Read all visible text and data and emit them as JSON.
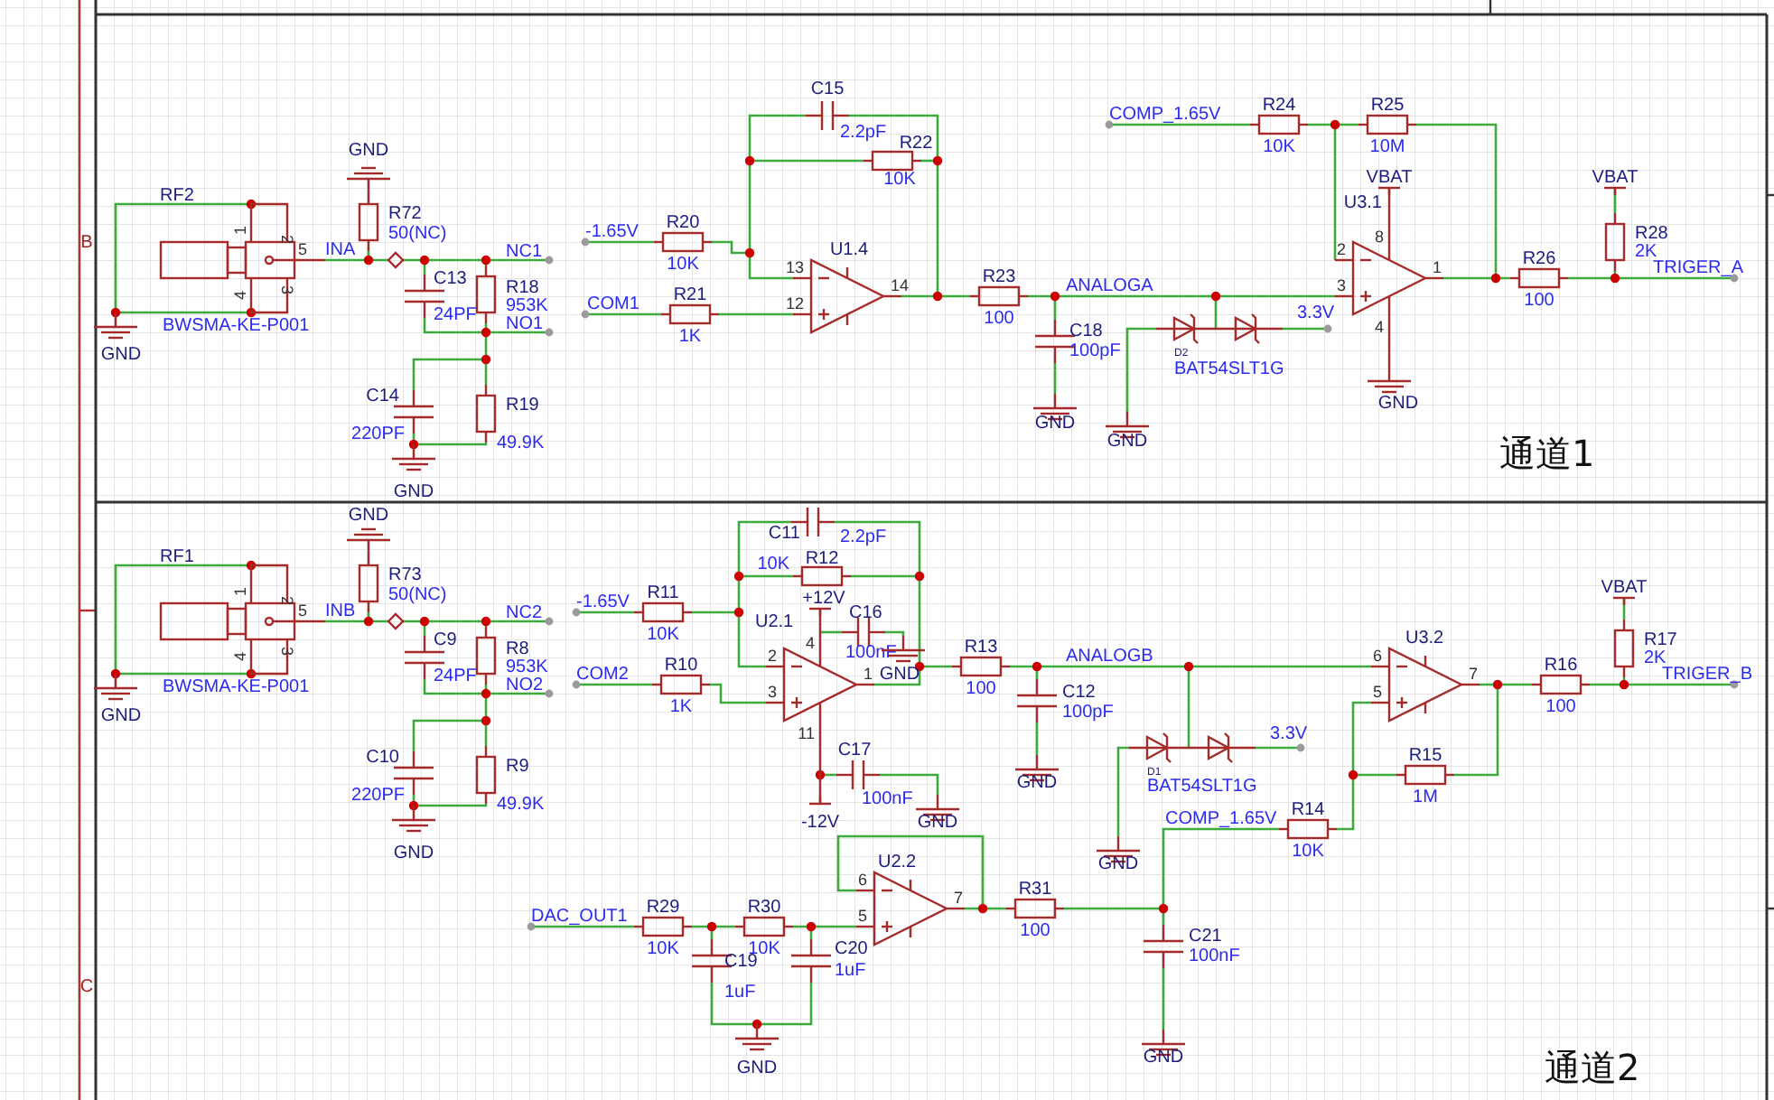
{
  "sheet": {
    "zone_labels": [
      "B",
      "C"
    ]
  },
  "channels": [
    {
      "title": "通道1",
      "parts": [
        {
          "kind": "connector",
          "ref": "RF2",
          "value": "BWSMA-KE-P001",
          "pins": [
            "1",
            "2",
            "4",
            "3",
            "5"
          ]
        },
        {
          "kind": "ground",
          "label": "GND"
        },
        {
          "kind": "ground",
          "label": "GND"
        },
        {
          "kind": "resistor",
          "ref": "R72",
          "value": "50(NC)"
        },
        {
          "kind": "net",
          "label": "INA"
        },
        {
          "kind": "capacitor",
          "ref": "C13",
          "value": "24PF"
        },
        {
          "kind": "net",
          "label": "NC1"
        },
        {
          "kind": "resistor",
          "ref": "R18",
          "value": "953K"
        },
        {
          "kind": "net",
          "label": "NO1"
        },
        {
          "kind": "capacitor",
          "ref": "C14",
          "value": "220PF"
        },
        {
          "kind": "resistor",
          "ref": "R19",
          "value": "49.9K"
        },
        {
          "kind": "ground",
          "label": "GND"
        },
        {
          "kind": "net",
          "label": "-1.65V"
        },
        {
          "kind": "resistor",
          "ref": "R20",
          "value": "10K"
        },
        {
          "kind": "net",
          "label": "COM1"
        },
        {
          "kind": "resistor",
          "ref": "R21",
          "value": "1K"
        },
        {
          "kind": "capacitor",
          "ref": "C15",
          "value": "2.2pF"
        },
        {
          "kind": "resistor",
          "ref": "R22",
          "value": "10K"
        },
        {
          "kind": "net",
          "label": "COMP_1.65V"
        },
        {
          "kind": "resistor",
          "ref": "R24",
          "value": "10K"
        },
        {
          "kind": "resistor",
          "ref": "R25",
          "value": "10M"
        },
        {
          "kind": "opamp",
          "ref": "U1.4",
          "pins": [
            "13",
            "12",
            "14"
          ]
        },
        {
          "kind": "resistor",
          "ref": "R23",
          "value": "100"
        },
        {
          "kind": "net",
          "label": "ANALOGA"
        },
        {
          "kind": "capacitor",
          "ref": "C18",
          "value": "100pF"
        },
        {
          "kind": "ground",
          "label": "GND"
        },
        {
          "kind": "diode_pair",
          "ref": "D2",
          "value": "BAT54SLT1G"
        },
        {
          "kind": "net",
          "label": "3.3V"
        },
        {
          "kind": "ground",
          "label": "GND"
        },
        {
          "kind": "power",
          "label": "VBAT"
        },
        {
          "kind": "opamp",
          "ref": "U3.1",
          "pins": [
            "2",
            "3",
            "1",
            "8",
            "4"
          ]
        },
        {
          "kind": "ground",
          "label": "GND"
        },
        {
          "kind": "resistor",
          "ref": "R26",
          "value": "100"
        },
        {
          "kind": "power",
          "label": "VBAT"
        },
        {
          "kind": "resistor",
          "ref": "R28",
          "value": "2K"
        },
        {
          "kind": "net",
          "label": "TRIGER_A"
        }
      ]
    },
    {
      "title": "通道2",
      "parts": [
        {
          "kind": "connector",
          "ref": "RF1",
          "value": "BWSMA-KE-P001",
          "pins": [
            "1",
            "2",
            "4",
            "3",
            "5"
          ]
        },
        {
          "kind": "ground",
          "label": "GND"
        },
        {
          "kind": "ground",
          "label": "GND"
        },
        {
          "kind": "resistor",
          "ref": "R73",
          "value": "50(NC)"
        },
        {
          "kind": "net",
          "label": "INB"
        },
        {
          "kind": "capacitor",
          "ref": "C9",
          "value": "24PF"
        },
        {
          "kind": "net",
          "label": "NC2"
        },
        {
          "kind": "resistor",
          "ref": "R8",
          "value": "953K"
        },
        {
          "kind": "net",
          "label": "NO2"
        },
        {
          "kind": "capacitor",
          "ref": "C10",
          "value": "220PF"
        },
        {
          "kind": "resistor",
          "ref": "R9",
          "value": "49.9K"
        },
        {
          "kind": "ground",
          "label": "GND"
        },
        {
          "kind": "net",
          "label": "-1.65V"
        },
        {
          "kind": "resistor",
          "ref": "R11",
          "value": "10K"
        },
        {
          "kind": "net",
          "label": "COM2"
        },
        {
          "kind": "resistor",
          "ref": "R10",
          "value": "1K"
        },
        {
          "kind": "opamp",
          "ref": "U2.1",
          "pins": [
            "2",
            "3",
            "1",
            "4",
            "11"
          ]
        },
        {
          "kind": "power",
          "label": "+12V"
        },
        {
          "kind": "capacitor",
          "ref": "C16",
          "value": "100nF"
        },
        {
          "kind": "ground",
          "label": "GND"
        },
        {
          "kind": "capacitor",
          "ref": "C11",
          "value": "2.2pF"
        },
        {
          "kind": "resistor",
          "ref": "R12",
          "value": "10K"
        },
        {
          "kind": "capacitor",
          "ref": "C17",
          "value": "100nF"
        },
        {
          "kind": "power",
          "label": "-12V"
        },
        {
          "kind": "ground",
          "label": "GND"
        },
        {
          "kind": "resistor",
          "ref": "R13",
          "value": "100"
        },
        {
          "kind": "net",
          "label": "ANALOGB"
        },
        {
          "kind": "capacitor",
          "ref": "C12",
          "value": "100pF"
        },
        {
          "kind": "ground",
          "label": "GND"
        },
        {
          "kind": "diode_pair",
          "ref": "D1",
          "value": "BAT54SLT1G"
        },
        {
          "kind": "net",
          "label": "3.3V"
        },
        {
          "kind": "ground",
          "label": "GND"
        },
        {
          "kind": "opamp",
          "ref": "U3.2",
          "pins": [
            "6",
            "5",
            "7"
          ]
        },
        {
          "kind": "resistor",
          "ref": "R16",
          "value": "100"
        },
        {
          "kind": "power",
          "label": "VBAT"
        },
        {
          "kind": "resistor",
          "ref": "R17",
          "value": "2K"
        },
        {
          "kind": "net",
          "label": "TRIGER_B"
        },
        {
          "kind": "resistor",
          "ref": "R15",
          "value": "1M"
        },
        {
          "kind": "resistor",
          "ref": "R14",
          "value": "10K"
        },
        {
          "kind": "net",
          "label": "COMP_1.65V"
        },
        {
          "kind": "opamp",
          "ref": "U2.2",
          "pins": [
            "6",
            "5",
            "7"
          ]
        },
        {
          "kind": "resistor",
          "ref": "R31",
          "value": "100"
        },
        {
          "kind": "capacitor",
          "ref": "C21",
          "value": "100nF"
        },
        {
          "kind": "ground",
          "label": "GND"
        },
        {
          "kind": "net",
          "label": "DAC_OUT1"
        },
        {
          "kind": "resistor",
          "ref": "R29",
          "value": "10K"
        },
        {
          "kind": "resistor",
          "ref": "R30",
          "value": "10K"
        },
        {
          "kind": "capacitor",
          "ref": "C19",
          "value": "1uF"
        },
        {
          "kind": "capacitor",
          "ref": "C20",
          "value": "1uF"
        },
        {
          "kind": "ground",
          "label": "GND"
        }
      ]
    }
  ]
}
